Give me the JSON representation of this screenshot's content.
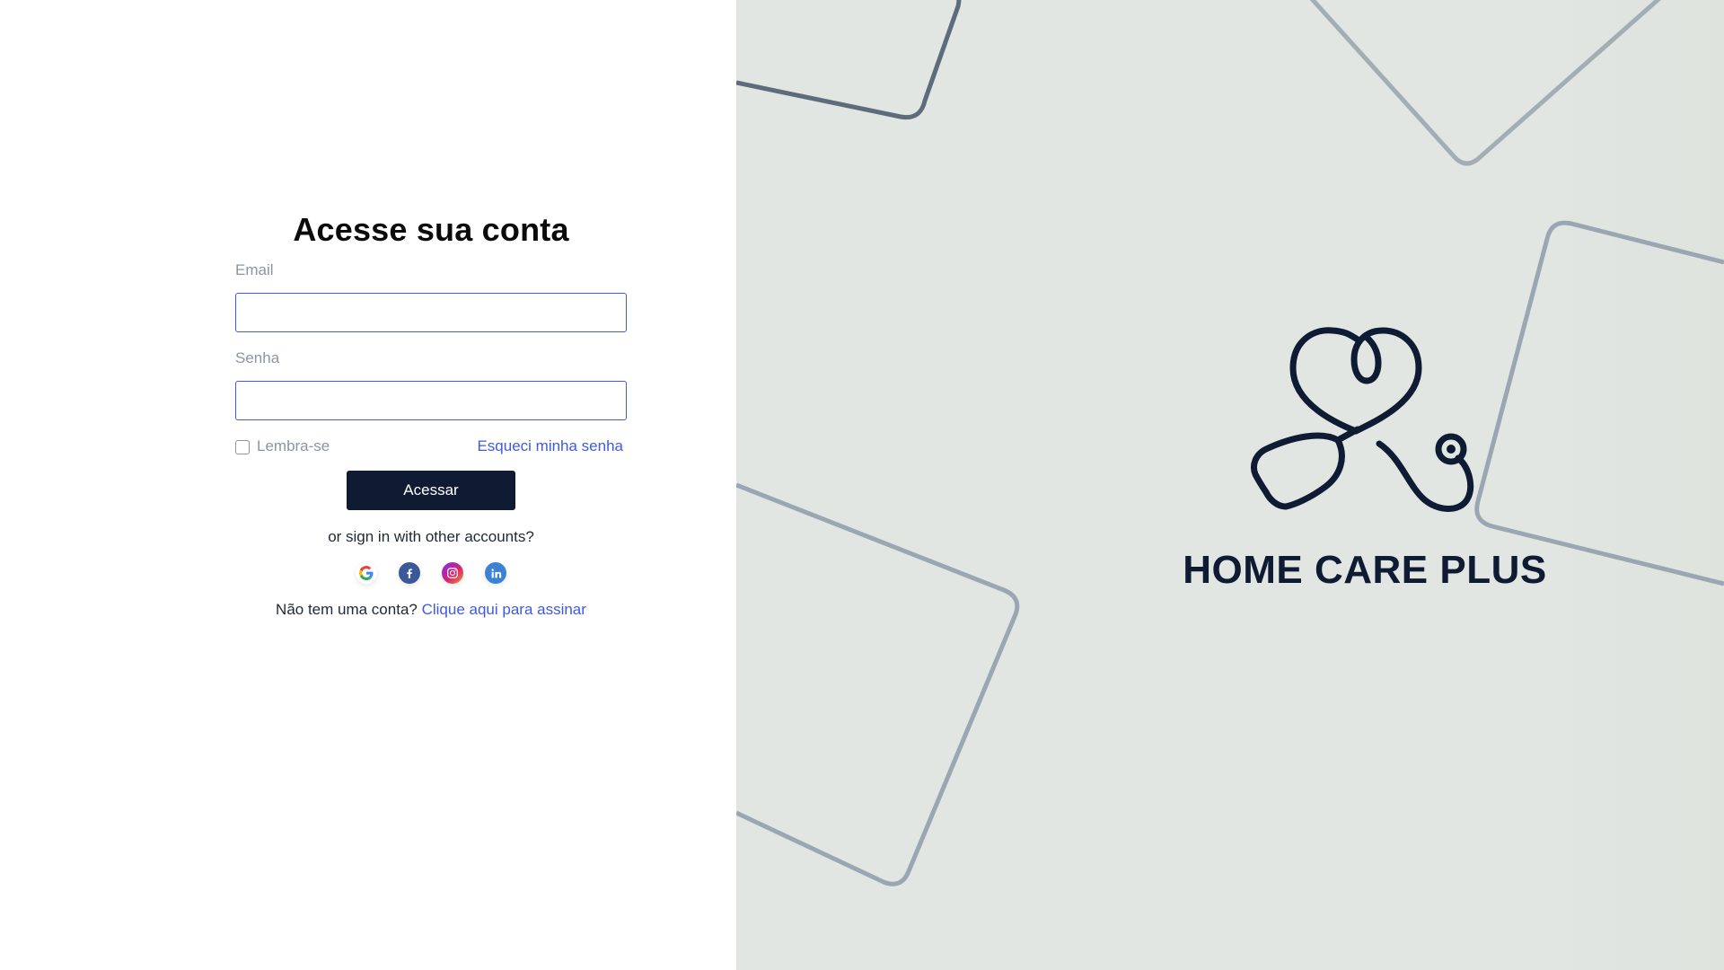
{
  "login": {
    "title": "Acesse sua conta",
    "email_label": "Email",
    "email_value": "",
    "password_label": "Senha",
    "password_value": "",
    "remember_label": "Lembra-se",
    "remember_checked": false,
    "forgot_password_link": "Esqueci minha senha",
    "submit_label": "Acessar",
    "alt_signin_text": "or sign in with other accounts?",
    "social_icons": [
      "google-icon",
      "facebook-icon",
      "instagram-icon",
      "linkedin-icon"
    ],
    "signup_prompt": "Não tem uma conta?",
    "signup_link": "Clique aqui para assinar"
  },
  "brand": {
    "name": "HOME CARE PLUS",
    "logo_icon": "stethoscope-heart-icon"
  },
  "colors": {
    "primary_dark": "#0e1b33",
    "accent_blue": "#3f5ae0",
    "muted_text": "#8d94a3",
    "right_panel_bg": "#e1e6e3",
    "shape_stroke": "#9aa7b2"
  }
}
